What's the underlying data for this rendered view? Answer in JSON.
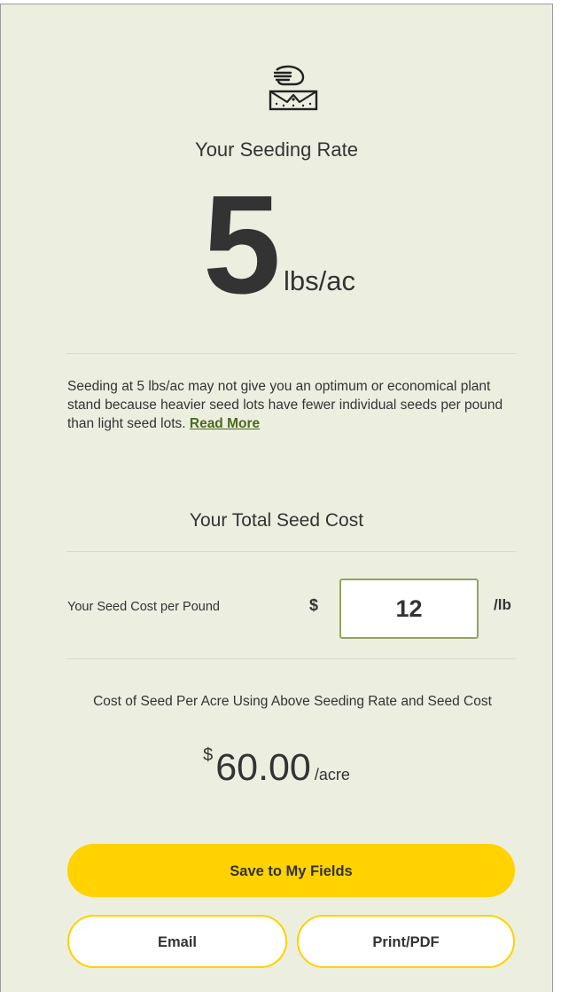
{
  "seeding_rate": {
    "icon": "hand-planting-seed-icon",
    "title": "Your Seeding Rate",
    "value": "5",
    "unit": "lbs/ac"
  },
  "advisory": {
    "text": "Seeding at 5 lbs/ac may not give you an optimum or economical plant stand because heavier seed lots have fewer individual seeds per pound than light seed lots. ",
    "link_label": "Read More"
  },
  "seed_cost": {
    "title": "Your Total Seed Cost",
    "label": "Your Seed Cost per Pound",
    "currency": "$",
    "value": "12",
    "per_unit": "/lb"
  },
  "per_acre": {
    "label": "Cost of Seed Per Acre Using Above Seeding Rate and Seed Cost",
    "currency": "$",
    "amount": "60.00",
    "unit": "/acre"
  },
  "actions": {
    "save_label": "Save to My Fields",
    "email_label": "Email",
    "print_label": "Print/PDF"
  },
  "colors": {
    "panel_background": "#ecefe0",
    "accent_yellow": "#ffd200",
    "link_green": "#4b6a1d",
    "input_border": "#94a55e",
    "text": "#333333"
  }
}
